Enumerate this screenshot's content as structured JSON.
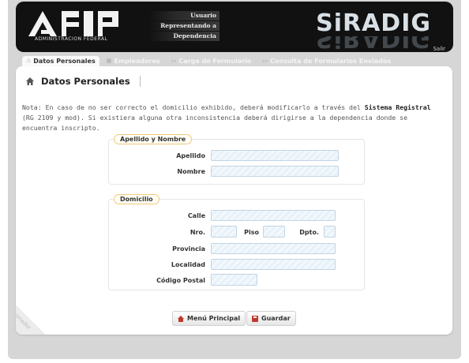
{
  "header": {
    "logo_text": "AFIP",
    "logo_subtitle": "ADMINISTRACION FEDERAL",
    "user_rows": [
      "Usuario",
      "Representando a",
      "Dependencia"
    ],
    "brand": "SiRADIG",
    "logout": "Salir"
  },
  "tabs": [
    {
      "label": "Datos Personales",
      "active": true,
      "icon": "person-icon"
    },
    {
      "label": "Empleadores",
      "active": false,
      "icon": "building-icon"
    },
    {
      "label": "Carga de Formulario",
      "active": false,
      "icon": "document-icon"
    },
    {
      "label": "Consulta de Formularios Enviados",
      "active": false,
      "icon": "folder-icon"
    }
  ],
  "page": {
    "title": "Datos Personales",
    "note_prefix": "Nota: En caso de no ser correcto el domicilio exhibido, deberá modificarlo a través del ",
    "note_link": "Sistema Registral",
    "note_suffix": " (RG 2109 y mod). Si existiera alguna otra inconsistencia deberá dirigirse a la dependencia donde se encuentra inscripto."
  },
  "section_name": {
    "legend": "Apellido y Nombre",
    "apellido_label": "Apellido",
    "nombre_label": "Nombre"
  },
  "section_address": {
    "legend": "Domicilio",
    "calle_label": "Calle",
    "nro_label": "Nro.",
    "piso_label": "Piso",
    "dpto_label": "Dpto.",
    "provincia_label": "Provincia",
    "localidad_label": "Localidad",
    "cp_label": "Código Postal"
  },
  "buttons": {
    "menu": "Menú Principal",
    "save": "Guardar"
  },
  "watermark": "borrador",
  "colors": {
    "header_bg": "#111111",
    "legend_border": "#f0c97a",
    "input_border": "#c2d4e2",
    "button_icon": "#c0392b"
  }
}
